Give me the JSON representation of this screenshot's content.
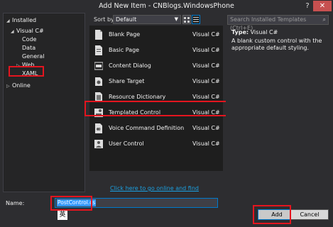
{
  "window": {
    "title": "Add New Item - CNBlogs.WindowsPhone",
    "help_glyph": "?",
    "close_glyph": "✕"
  },
  "tree": [
    {
      "label": "Installed",
      "expander": "◢",
      "indent": 0
    },
    {
      "label": "Visual C#",
      "expander": "◢",
      "indent": 1
    },
    {
      "label": "Code",
      "expander": "",
      "indent": 2
    },
    {
      "label": "Data",
      "expander": "",
      "indent": 2
    },
    {
      "label": "General",
      "expander": "",
      "indent": 2
    },
    {
      "label": "Web",
      "expander": "▷",
      "indent": 2
    },
    {
      "label": "XAML",
      "expander": "",
      "indent": 2
    },
    {
      "label": "Online",
      "expander": "▷",
      "indent": 0
    }
  ],
  "sort": {
    "label": "Sort by:",
    "value": "Default",
    "chevron": "▼"
  },
  "templates": [
    {
      "name": "Blank Page",
      "lang": "Visual C#",
      "icon": "page-icon"
    },
    {
      "name": "Basic Page",
      "lang": "Visual C#",
      "icon": "page-icon"
    },
    {
      "name": "Content Dialog",
      "lang": "Visual C#",
      "icon": "dialog-icon"
    },
    {
      "name": "Share Target",
      "lang": "Visual C#",
      "icon": "share-icon"
    },
    {
      "name": "Resource Dictionary",
      "lang": "Visual C#",
      "icon": "resource-icon"
    },
    {
      "name": "Templated Control",
      "lang": "Visual C#",
      "icon": "control-icon"
    },
    {
      "name": "Voice Command Definition",
      "lang": "Visual C#",
      "icon": "voice-icon"
    },
    {
      "name": "User Control",
      "lang": "Visual C#",
      "icon": "user-control-icon"
    }
  ],
  "online_link": "Click here to go online and find templates.",
  "search": {
    "placeholder": "Search Installed Templates (Ctrl+E)",
    "glyph": "⌕"
  },
  "details": {
    "type_label": "Type:",
    "type_value": "Visual C#",
    "description": "A blank custom control with the appropriate default styling."
  },
  "name_field": {
    "label": "Name:",
    "value": "PostControl.cs"
  },
  "ime_char": "英",
  "buttons": {
    "add": "Add",
    "cancel": "Cancel"
  },
  "colors": {
    "accent": "#007acc",
    "highlight": "#e4151f",
    "link": "#1ba1e2"
  }
}
